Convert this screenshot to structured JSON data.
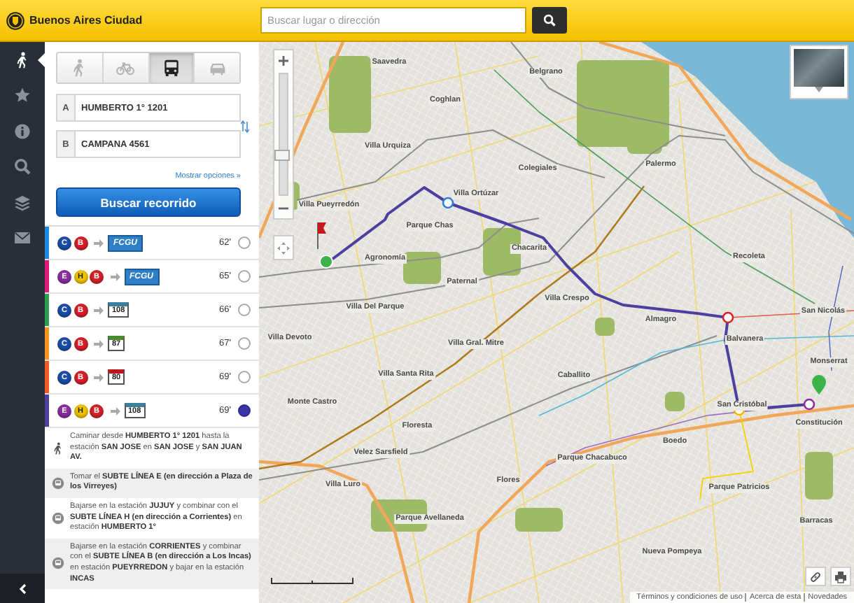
{
  "header": {
    "title": "Buenos Aires Ciudad",
    "search_placeholder": "Buscar lugar o dirección"
  },
  "rail": {
    "items": [
      {
        "kind": "walk",
        "selected": true
      },
      {
        "kind": "star",
        "selected": false
      },
      {
        "kind": "info",
        "selected": false
      },
      {
        "kind": "search",
        "selected": false
      },
      {
        "kind": "layers",
        "selected": false
      },
      {
        "kind": "mail",
        "selected": false
      }
    ]
  },
  "modes": [
    {
      "kind": "walk",
      "selected": false
    },
    {
      "kind": "bike",
      "selected": false
    },
    {
      "kind": "bus",
      "selected": true
    },
    {
      "kind": "car",
      "selected": false
    }
  ],
  "origin": {
    "letter": "A",
    "value": "HUMBERTO 1° 1201"
  },
  "destination": {
    "letter": "B",
    "value": "CAMPANA 4561"
  },
  "more_options": "Mostrar opciones »",
  "search_button": "Buscar recorrido",
  "routes": [
    {
      "color": "#1e88e5",
      "lines": [
        {
          "letter": "C",
          "color": "#1b4fa8"
        },
        {
          "letter": "B",
          "color": "#d62128"
        }
      ],
      "transfer": {
        "kind": "train",
        "label": "FCGU",
        "color": "#2f7fc8"
      },
      "duration": "62'",
      "selected": false
    },
    {
      "color": "#e0197d",
      "lines": [
        {
          "letter": "E",
          "color": "#8c2e9c"
        },
        {
          "letter": "H",
          "color": "#f2c400"
        },
        {
          "letter": "B",
          "color": "#d62128"
        }
      ],
      "transfer": {
        "kind": "train",
        "label": "FCGU",
        "color": "#2f7fc8"
      },
      "duration": "65'",
      "selected": false
    },
    {
      "color": "#2e9e4f",
      "lines": [
        {
          "letter": "C",
          "color": "#1b4fa8"
        },
        {
          "letter": "B",
          "color": "#d62128"
        }
      ],
      "transfer": {
        "kind": "bus",
        "label": "108",
        "color": "#3a7f9c"
      },
      "duration": "66'",
      "selected": false
    },
    {
      "color": "#f7941d",
      "lines": [
        {
          "letter": "C",
          "color": "#1b4fa8"
        },
        {
          "letter": "B",
          "color": "#d62128"
        }
      ],
      "transfer": {
        "kind": "bus",
        "label": "87",
        "color": "#4c8a2e"
      },
      "duration": "67'",
      "selected": false
    },
    {
      "color": "#f15a24",
      "lines": [
        {
          "letter": "C",
          "color": "#1b4fa8"
        },
        {
          "letter": "B",
          "color": "#d62128"
        }
      ],
      "transfer": {
        "kind": "bus",
        "label": "80",
        "color": "#c0121b"
      },
      "duration": "69'",
      "selected": false
    },
    {
      "color": "#4b3fa0",
      "lines": [
        {
          "letter": "E",
          "color": "#8c2e9c"
        },
        {
          "letter": "H",
          "color": "#f2c400"
        },
        {
          "letter": "B",
          "color": "#d62128"
        }
      ],
      "transfer": {
        "kind": "bus",
        "label": "108",
        "color": "#3a7f9c"
      },
      "duration": "69'",
      "selected": true
    }
  ],
  "steps": [
    {
      "kind": "walk",
      "text": "Caminar desde **HUMBERTO 1° 1201** hasta la estación **SAN JOSE** en **SAN JOSE** y **SAN JUAN AV.**"
    },
    {
      "kind": "subway",
      "text": "Tomar el **SUBTE LÍNEA E (en dirección a Plaza de los Virreyes)**"
    },
    {
      "kind": "subway",
      "text": "Bajarse en la estación **JUJUY** y combinar con el **SUBTE LÍNEA H (en dirección a Corrientes)** en estación **HUMBERTO 1°**"
    },
    {
      "kind": "subway",
      "text": "Bajarse en la estación **CORRIENTES** y combinar con el **SUBTE LÍNEA B (en dirección a Los Incas)** en estación **PUEYRREDON** y bajar en la estación **INCAS**"
    }
  ],
  "map": {
    "zoom_slider": {
      "level": 0.32
    },
    "places": [
      "Saavedra",
      "Belgrano",
      "Coghlan",
      "Villa Urquiza",
      "Colegiales",
      "Palermo",
      "Villa Ortúzar",
      "Villa Pueyrredón",
      "Parque Chas",
      "Chacarita",
      "Agronomía",
      "Recoleta",
      "Paternal",
      "Villa Crespo",
      "Villa Del Parque",
      "Almagro",
      "San Nicolás",
      "Villa Devoto",
      "Balvanera",
      "Villa Gral. Mitre",
      "Monserrat",
      "Villa Santa Rita",
      "Caballito",
      "Monte Castro",
      "San Cristóbal",
      "Constitución",
      "Floresta",
      "Boedo",
      "Velez Sarsfield",
      "Parque Chacabuco",
      "Villa Luro",
      "Flores",
      "Parque Patricios",
      "Parque Avellaneda",
      "Nueva Pompeya",
      "Barracas"
    ],
    "footer_links": [
      "Términos y condiciones de uso",
      "Acerca de esta",
      "Novedades"
    ]
  }
}
